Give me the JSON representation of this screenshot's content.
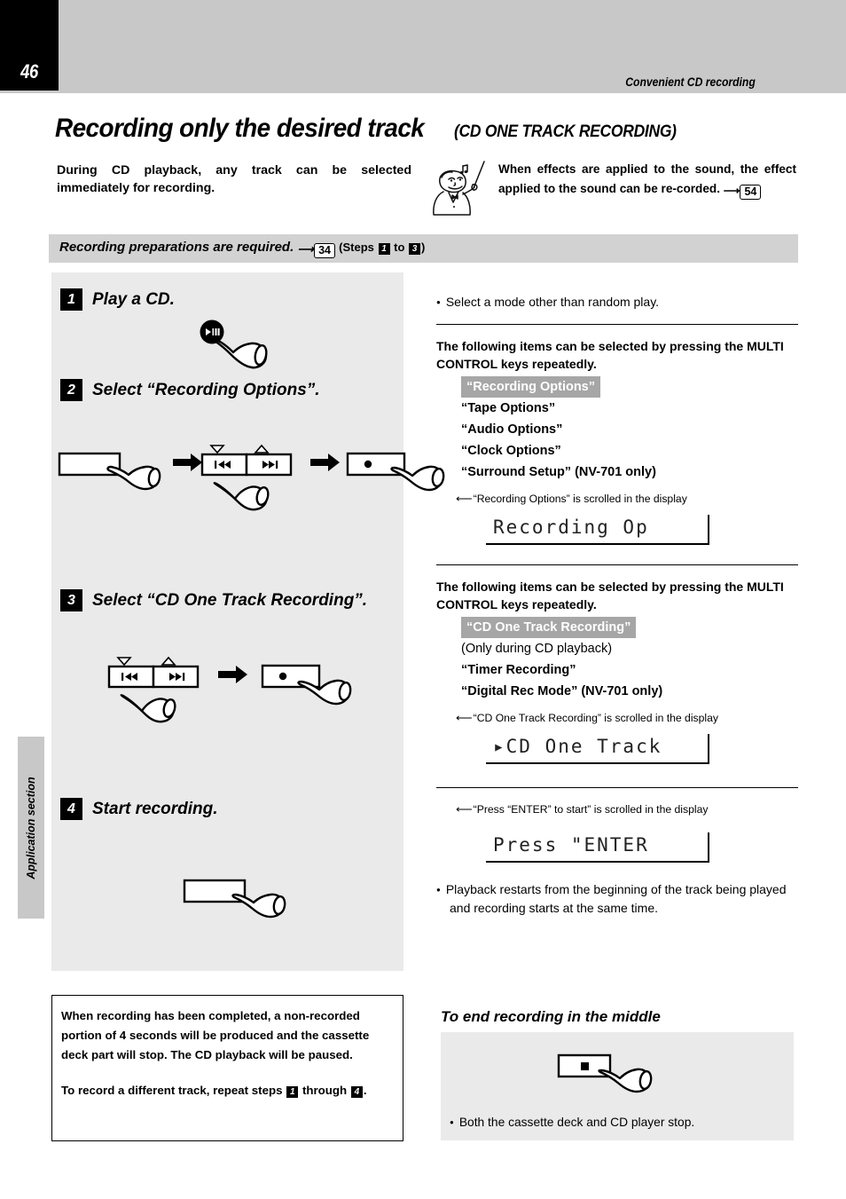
{
  "header": {
    "page_number": "46",
    "section_title": "Convenient CD recording",
    "side_tab": "Application section"
  },
  "title": {
    "main": "Recording only the desired track",
    "sub": "(CD ONE TRACK RECORDING)"
  },
  "intro": {
    "left_text": "During CD playback, any track can be selected immediately for recording.",
    "right_text": "When effects are applied to the sound, the effect applied to the sound can be re-corded.",
    "right_page_ref": "54"
  },
  "prep_bar": {
    "text": "Recording preparations are required.",
    "page_ref": "34",
    "steps_prefix": "(Steps",
    "steps_from": "1",
    "steps_to_word": "to",
    "steps_to": "3",
    "steps_suffix": ")"
  },
  "steps": [
    {
      "num": "1",
      "label": "Play  a CD."
    },
    {
      "num": "2",
      "label": "Select “Recording Options”."
    },
    {
      "num": "3",
      "label": "Select “CD One Track Recording”."
    },
    {
      "num": "4",
      "label": "Start recording."
    }
  ],
  "right": {
    "mode_bullet": "Select a mode other than random play.",
    "block1": {
      "heading": "The following items can be selected by pressing the MULTI CONTROL keys repeatedly.",
      "items": [
        {
          "label": "“Recording Options”",
          "selected": true
        },
        {
          "label": "“Tape Options”",
          "selected": false
        },
        {
          "label": "“Audio Options”",
          "selected": false
        },
        {
          "label": "“Clock Options”",
          "selected": false
        },
        {
          "label": "“Surround Setup” (NV-701 only)",
          "selected": false
        }
      ],
      "scroll_note": "“Recording Options” is scrolled in the display",
      "lcd_text": "Recording Op"
    },
    "block2": {
      "heading": "The following items can be selected by pressing the MULTI CONTROL keys repeatedly.",
      "items": [
        {
          "label": "“CD One Track Recording”",
          "selected": true
        },
        {
          "label": "(Only during CD playback)",
          "selected": false,
          "plain": true
        },
        {
          "label": "“Timer Recording”",
          "selected": false
        },
        {
          "label": "“Digital Rec Mode” (NV-701 only)",
          "selected": false
        }
      ],
      "scroll_note": "“CD One Track Recording” is scrolled in the display",
      "lcd_text": "▸CD One Track"
    },
    "block3": {
      "scroll_note": "“Press “ENTER” to start” is scrolled in the display",
      "lcd_text": "Press \"ENTER",
      "bullet": "Playback restarts from the beginning of the track being played and recording starts at the same time."
    }
  },
  "note_box": {
    "paragraph1": "When recording has been completed, a non-recorded portion of 4 seconds will be produced and the cassette deck part will stop. The CD playback will be paused.",
    "paragraph2_pre": "To record a different track, repeat steps",
    "paragraph2_step_from": "1",
    "paragraph2_mid": "through",
    "paragraph2_step_to": "4",
    "paragraph2_post": "."
  },
  "end_section": {
    "heading": "To end recording in the middle",
    "bullet": "Both the cassette deck and CD player stop."
  },
  "colors": {
    "header_band": "#c8c8c8",
    "panel_bg": "#eaeaea",
    "prep_bar": "#d2d2d2",
    "highlight": "#a6a6a6",
    "black": "#000000"
  }
}
